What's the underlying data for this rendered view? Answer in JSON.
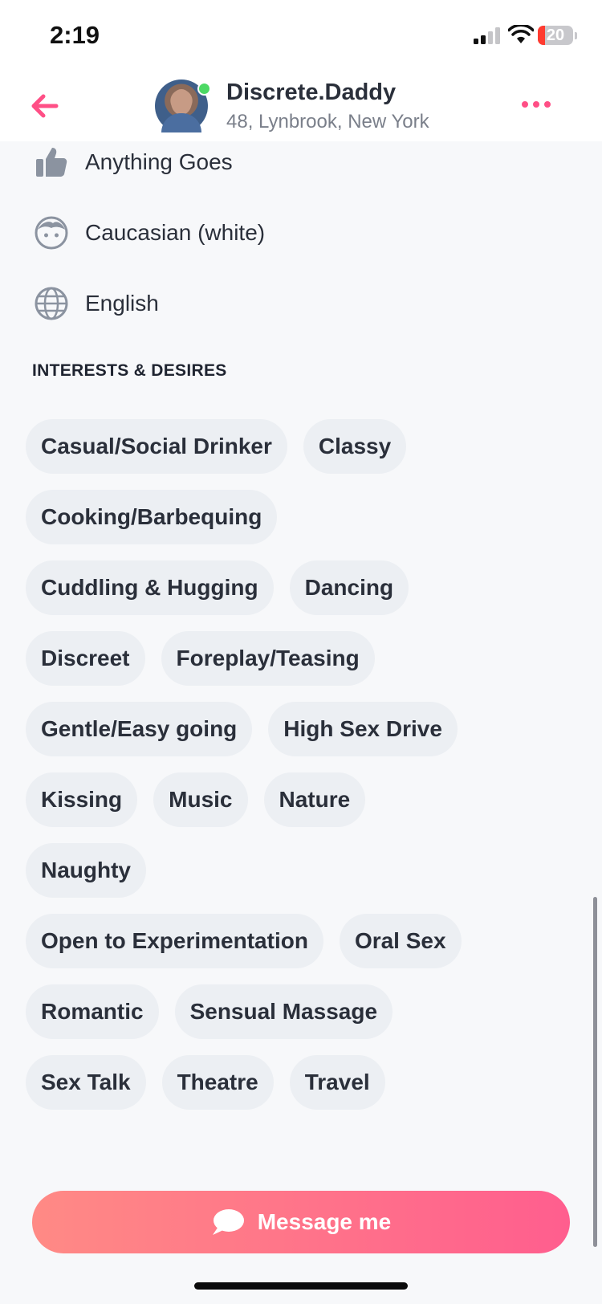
{
  "status": {
    "time": "2:19",
    "battery": "20",
    "battery_fraction": 0.2
  },
  "header": {
    "back_icon": "arrow-left-icon",
    "name": "Discrete.Daddy",
    "location": "48, Lynbrook, New York",
    "more_icon": "more-horizontal-icon",
    "accent_color": "#ff4f86",
    "online_color": "#4cd964"
  },
  "details": [
    {
      "icon": "thumbs-up-icon",
      "label": "Anything Goes"
    },
    {
      "icon": "face-icon",
      "label": "Caucasian (white)"
    },
    {
      "icon": "globe-icon",
      "label": "English"
    }
  ],
  "interests": {
    "title": "INTERESTS & DESIRES",
    "tags": [
      "Casual/Social Drinker",
      "Classy",
      "Cooking/Barbequing",
      "Cuddling & Hugging",
      "Dancing",
      "Discreet",
      "Foreplay/Teasing",
      "Gentle/Easy going",
      "High Sex Drive",
      "Kissing",
      "Music",
      "Nature",
      "Naughty",
      "Open to Experimentation",
      "Oral Sex",
      "Romantic",
      "Sensual Massage",
      "Sex Talk",
      "Theatre",
      "Travel"
    ]
  },
  "cta": {
    "label": "Message me",
    "icon": "chat-bubble-icon"
  }
}
